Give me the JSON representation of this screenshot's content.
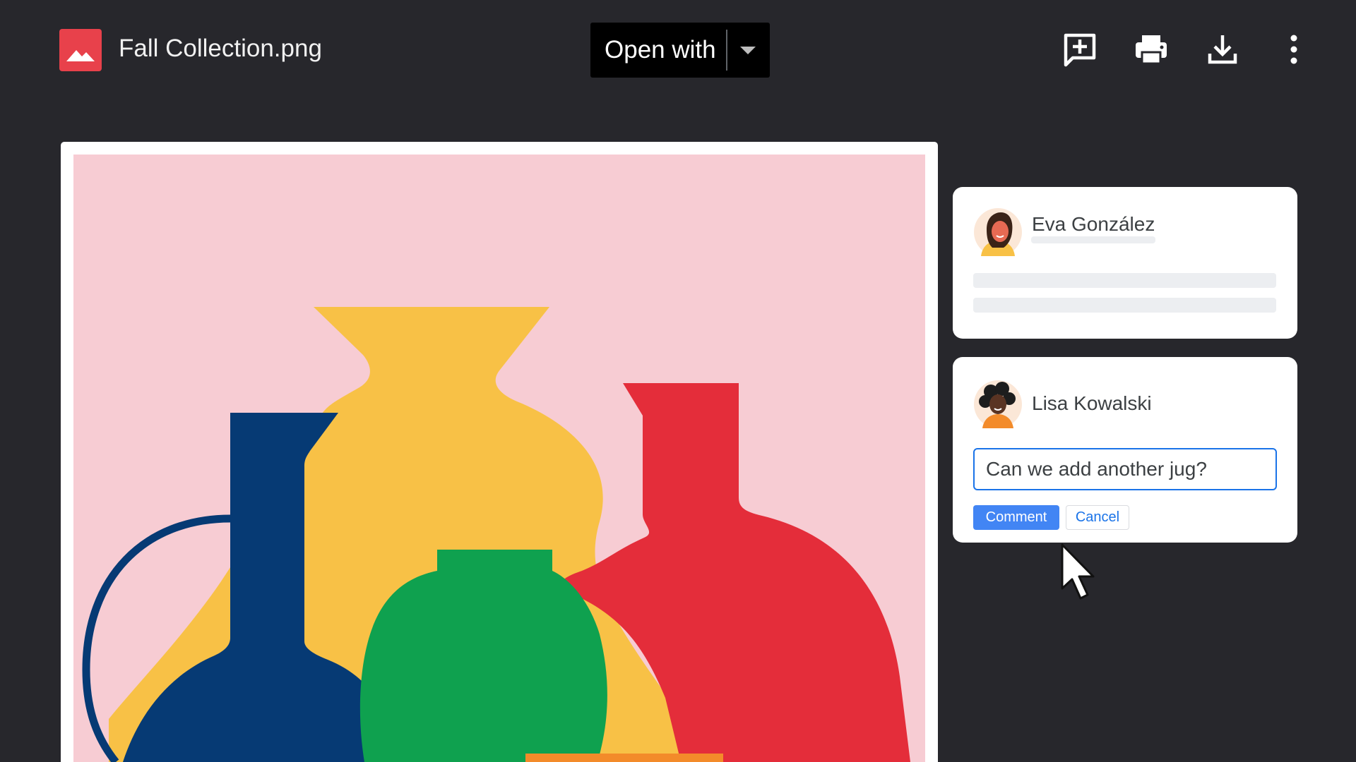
{
  "header": {
    "file_name": "Fall Collection.png",
    "file_icon": "image-file-icon",
    "open_with_label": "Open with",
    "actions": [
      {
        "name": "add-comment-icon"
      },
      {
        "name": "print-icon"
      },
      {
        "name": "download-icon"
      },
      {
        "name": "more-options-icon"
      }
    ]
  },
  "preview": {
    "image_name": "fall-collection-vases-illustration",
    "colors": {
      "background": "#f7ccd3",
      "navy": "#063a74",
      "yellow": "#f8c146",
      "red": "#e42d3a",
      "green": "#0fa14f",
      "orange": "#f38b2a"
    }
  },
  "comments": [
    {
      "author": "Eva González",
      "avatar": "woman-avatar"
    },
    {
      "author": "Lisa Kowalski",
      "avatar": "woman-curly-hair-avatar",
      "input_value": "Can we add another jug?",
      "submit_label": "Comment",
      "cancel_label": "Cancel"
    }
  ],
  "colors": {
    "app_background": "#27272c",
    "accent": "#4285f4",
    "focus": "#1a73e8",
    "file_icon": "#e8414b"
  }
}
